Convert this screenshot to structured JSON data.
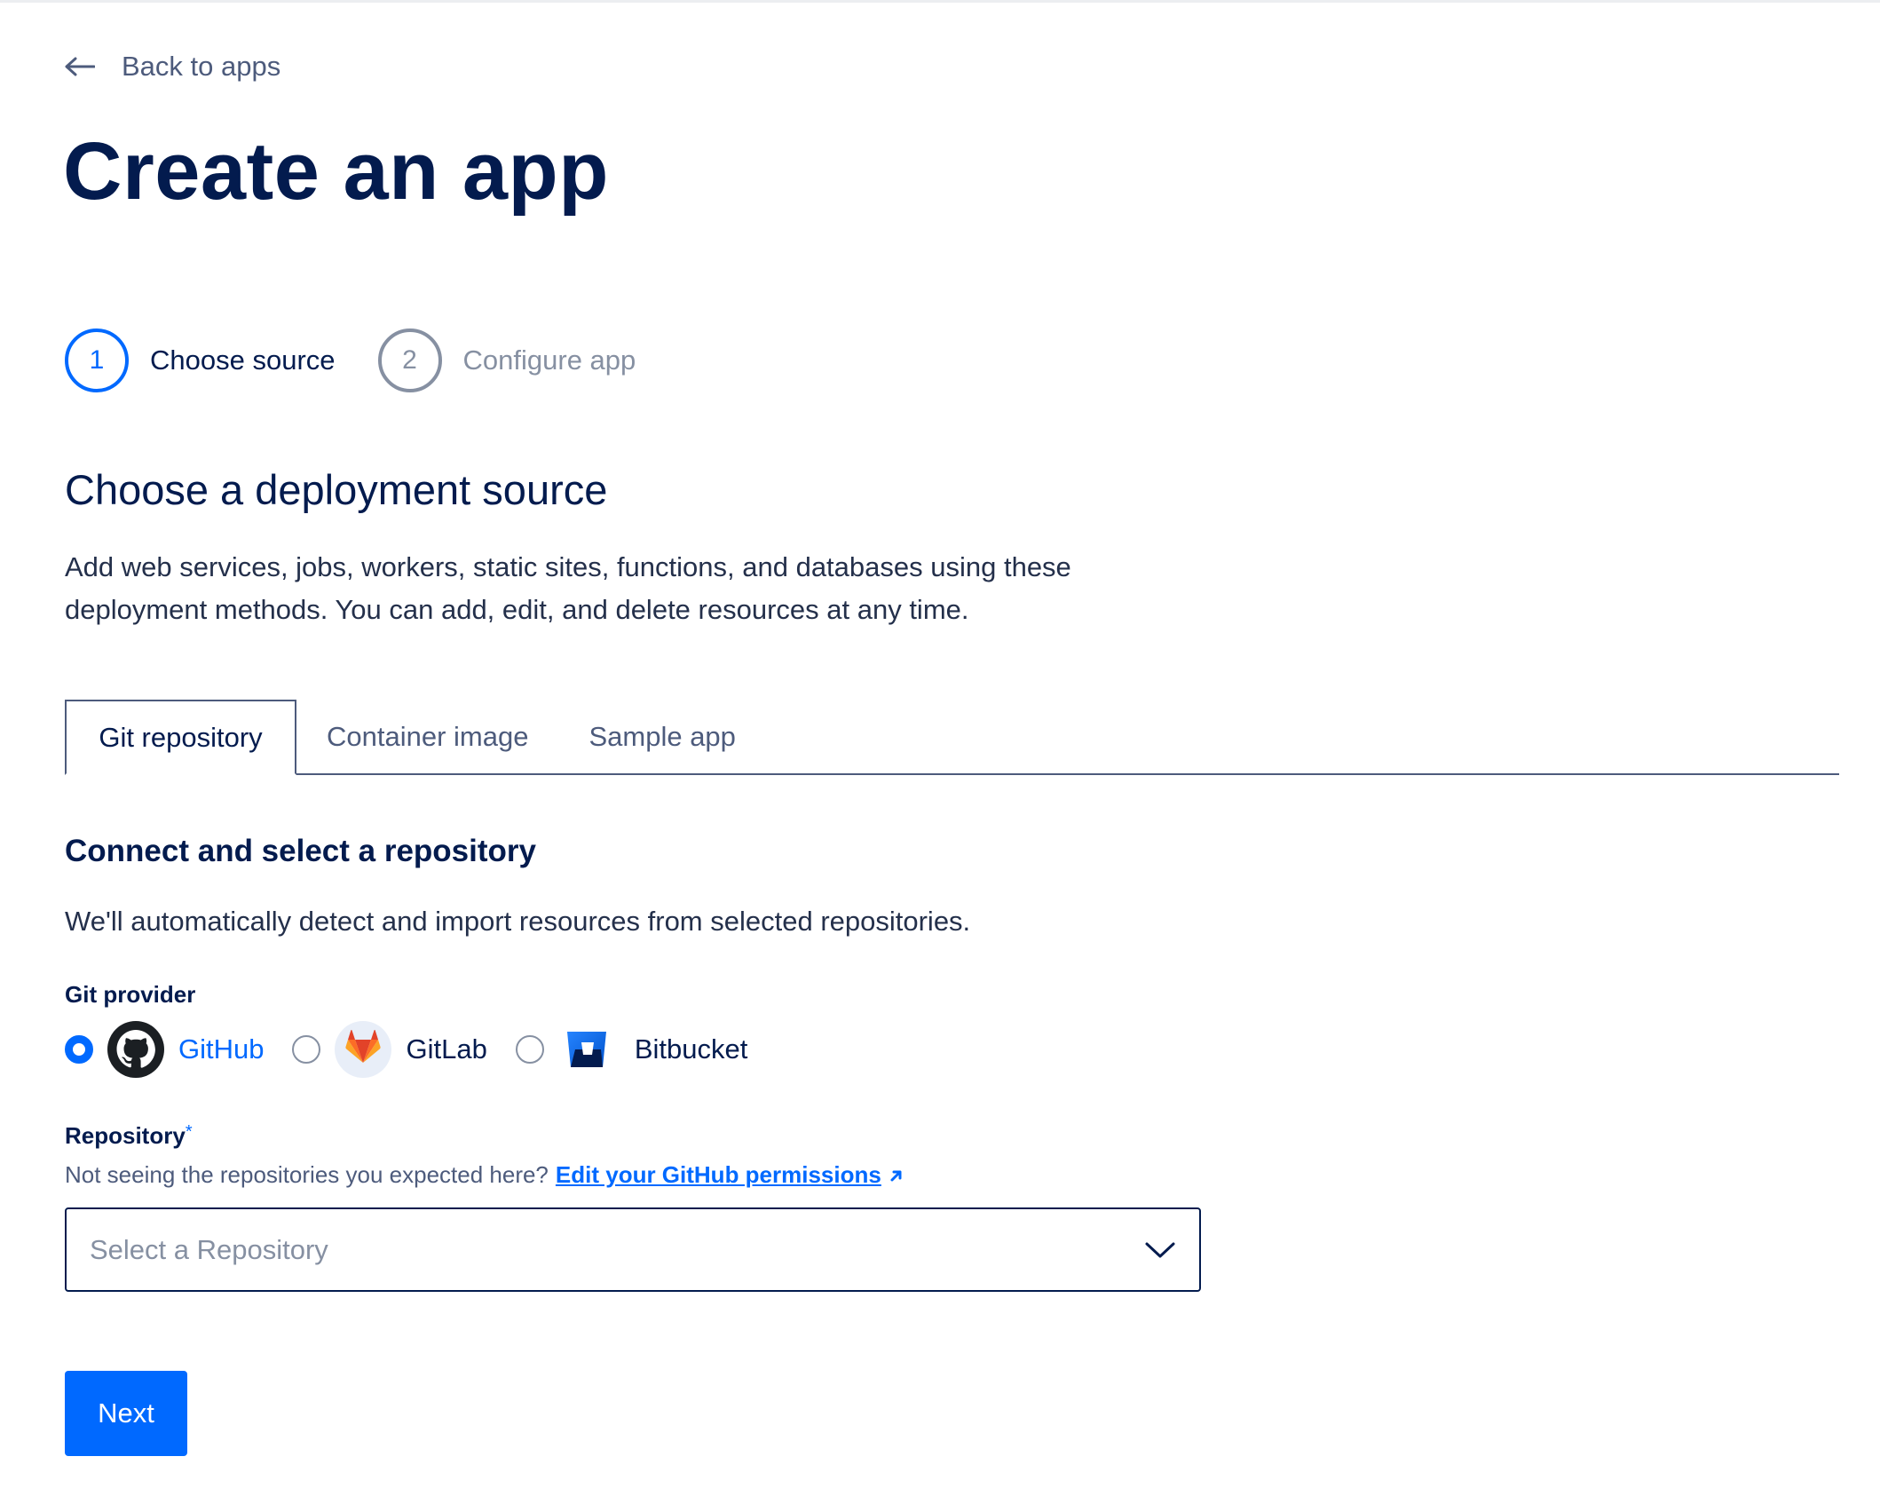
{
  "nav": {
    "back_label": "Back to apps"
  },
  "page": {
    "title": "Create an app"
  },
  "stepper": {
    "steps": [
      {
        "number": "1",
        "label": "Choose source",
        "state": "active"
      },
      {
        "number": "2",
        "label": "Configure app",
        "state": "inactive"
      }
    ]
  },
  "section": {
    "title": "Choose a deployment source",
    "description": "Add web services, jobs, workers, static sites, functions, and databases using these deployment methods. You can add, edit, and delete resources at any time."
  },
  "tabs": [
    {
      "label": "Git repository",
      "active": true
    },
    {
      "label": "Container image",
      "active": false
    },
    {
      "label": "Sample app",
      "active": false
    }
  ],
  "repo_section": {
    "title": "Connect and select a repository",
    "description": "We'll automatically detect and import resources from selected repositories."
  },
  "git_provider": {
    "label": "Git provider",
    "options": [
      {
        "name": "GitHub",
        "icon": "github-icon",
        "selected": true
      },
      {
        "name": "GitLab",
        "icon": "gitlab-icon",
        "selected": false
      },
      {
        "name": "Bitbucket",
        "icon": "bitbucket-icon",
        "selected": false
      }
    ]
  },
  "repository": {
    "label": "Repository",
    "required_mark": "*",
    "hint": "Not seeing the repositories you expected here?",
    "link": "Edit your GitHub permissions",
    "placeholder": "Select a Repository"
  },
  "actions": {
    "next_label": "Next"
  },
  "colors": {
    "primary": "#0069ff",
    "heading": "#031b4e",
    "muted": "#8690a2"
  }
}
